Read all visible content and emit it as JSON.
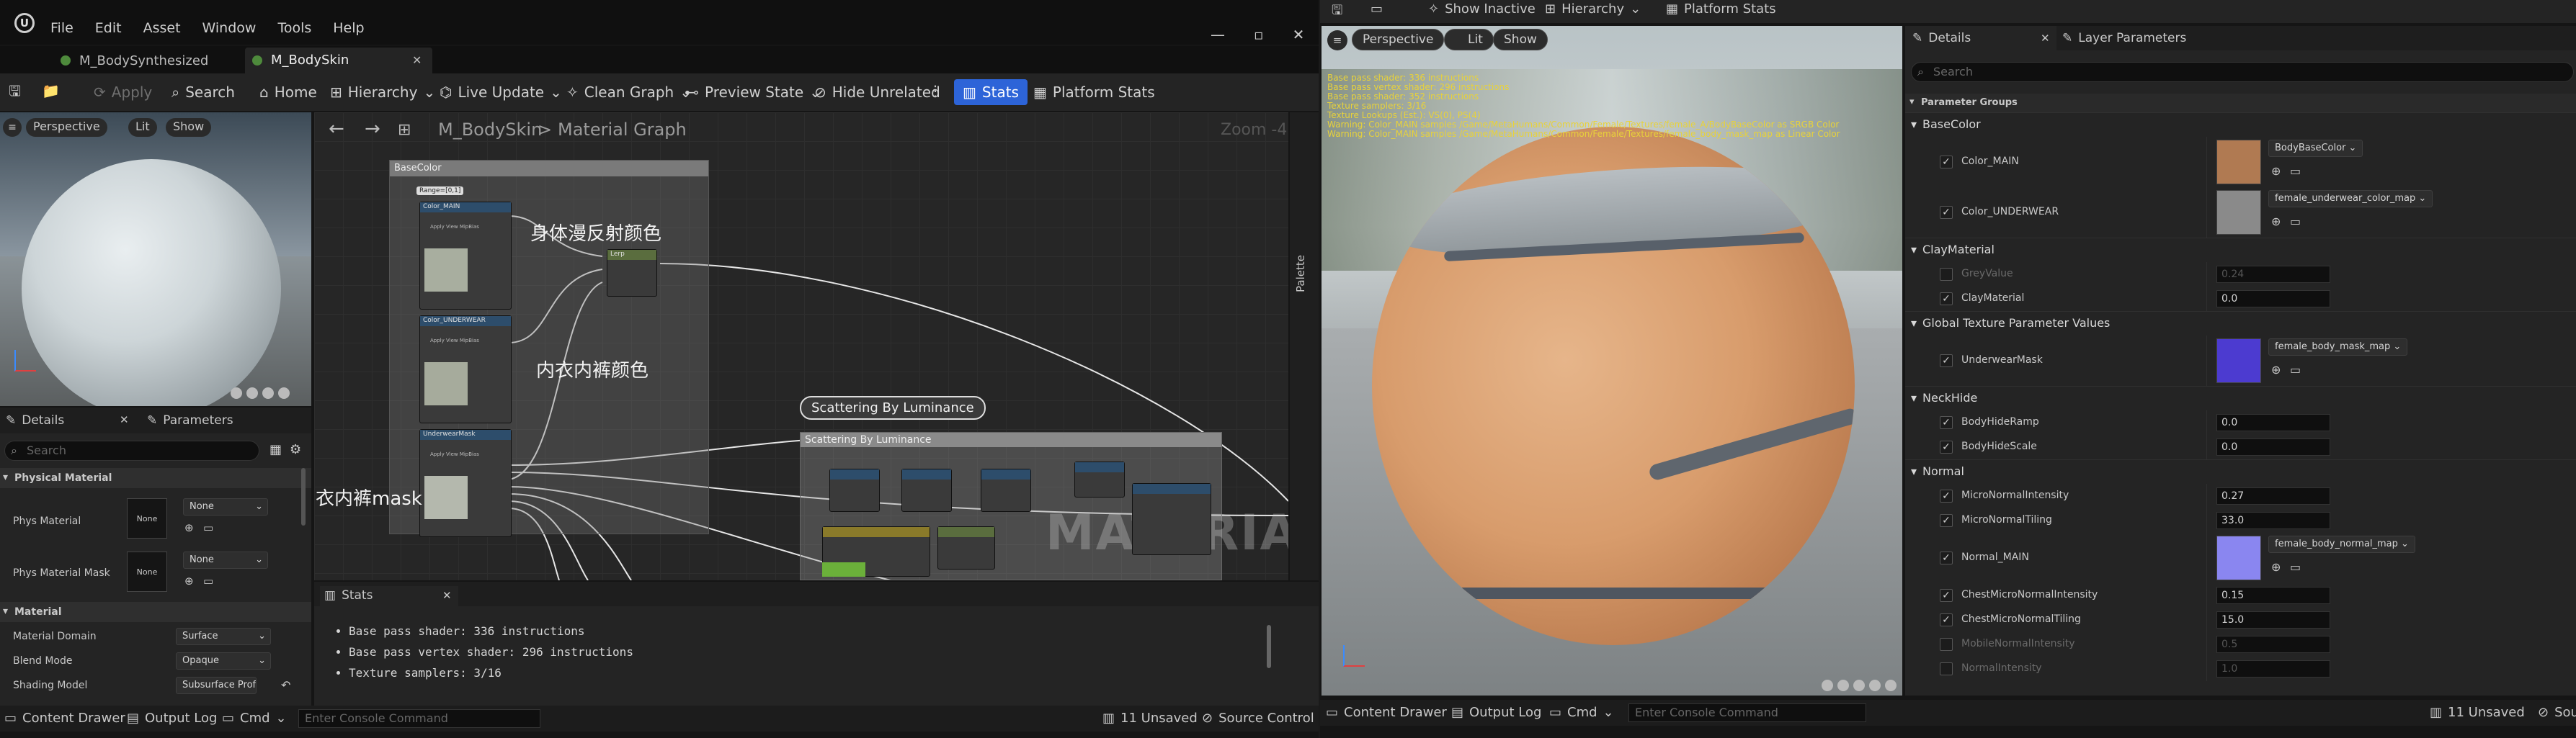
{
  "app": {
    "menu": [
      "File",
      "Edit",
      "Asset",
      "Window",
      "Tools",
      "Help"
    ],
    "tabs": [
      {
        "label": "M_BodySynthesized"
      },
      {
        "label": "M_BodySkin"
      }
    ]
  },
  "toolbar": {
    "apply": "Apply",
    "search": "Search",
    "home": "Home",
    "hierarchy": "Hierarchy",
    "live_update": "Live Update",
    "clean_graph": "Clean Graph",
    "preview_state": "Preview State",
    "hide_unrelated": "Hide Unrelated",
    "stats": "Stats",
    "platform_stats": "Platform Stats"
  },
  "preview": {
    "perspective": "Perspective",
    "lit": "Lit",
    "show": "Show"
  },
  "left_details": {
    "tab_details": "Details",
    "tab_parameters": "Parameters",
    "search_placeholder": "Search",
    "section_physical": "Physical Material",
    "phys_material": "Phys Material",
    "phys_value": "None",
    "phys_thumb": "None",
    "phys_mask": "Phys Material Mask",
    "phys_mask_value": "None",
    "phys_mask_thumb": "None",
    "section_material": "Material",
    "material_domain": "Material Domain",
    "material_domain_value": "Surface",
    "blend_mode": "Blend Mode",
    "blend_mode_value": "Opaque",
    "shading_model": "Shading Model",
    "shading_model_value": "Subsurface Profile"
  },
  "graph": {
    "breadcrumb_root": "M_BodySkin",
    "breadcrumb_sep": ">",
    "breadcrumb_leaf": "Material Graph",
    "zoom": "Zoom -4",
    "palette": "Palette",
    "comment_basecolor": "BaseColor",
    "anno_body_diffuse": "身体漫反射颜色",
    "anno_underwear_color": "内衣内裤颜色",
    "anno_underwear_mask": "内衣内裤mask",
    "scatter_bubble": "Scattering By Luminance",
    "scatter_comment": "Scattering By Luminance",
    "watermark": "MATERIAL",
    "nodes": {
      "range": "Range=[0,1]",
      "color_main": "Color_MAIN",
      "color_underwear": "Color_UNDERWEAR",
      "underwear_mask": "UnderwearMask",
      "lerp": "Lerp",
      "apply_mip": "Apply View MipBias"
    }
  },
  "stats": {
    "title": "Stats",
    "lines": [
      "Base pass shader: 336 instructions",
      "Base pass vertex shader: 296 instructions",
      "Texture samplers: 3/16"
    ]
  },
  "statusbar_left": {
    "content_drawer": "Content Drawer",
    "output_log": "Output Log",
    "cmd": "Cmd",
    "console_placeholder": "Enter Console Command",
    "unsaved": "11 Unsaved",
    "source_control": "Source Control"
  },
  "right_top": {
    "show_inactive": "Show Inactive",
    "hierarchy": "Hierarchy",
    "platform_stats": "Platform Stats"
  },
  "viewport": {
    "perspective": "Perspective",
    "lit": "Lit",
    "show": "Show",
    "overlay_lines": [
      "Base pass shader: 336 instructions",
      "Base pass vertex shader: 296 instructions",
      "Base pass shader: 352 instructions",
      "Texture samplers: 3/16",
      "Texture Lookups (Est.): VS(0), PS(4)",
      "Warning: Color_MAIN samples /Game/MetaHumans/Common/Female/Textures/female_A/BodyBaseColor as SRGB Color",
      "Warning: Color_MAIN samples /Game/MetaHumans/Common/Female/Textures/female_body_mask_map as Linear Color"
    ]
  },
  "right_details": {
    "tab_details": "Details",
    "tab_layer": "Layer Parameters",
    "search_placeholder": "Search",
    "param_groups": "Parameter Groups",
    "groups": [
      {
        "name": "BaseColor",
        "rows": [
          {
            "label": "Color_MAIN",
            "checked": true,
            "type": "texture",
            "value": "BodyBaseColor",
            "swatch": "#b07a52"
          },
          {
            "label": "Color_UNDERWEAR",
            "checked": true,
            "type": "texture",
            "value": "female_underwear_color_map",
            "swatch": "#8a8a8a"
          }
        ]
      },
      {
        "name": "ClayMaterial",
        "rows": [
          {
            "label": "GreyValue",
            "checked": false,
            "type": "value",
            "value": "0.24"
          },
          {
            "label": "ClayMaterial",
            "checked": true,
            "type": "value",
            "value": "0.0"
          }
        ]
      },
      {
        "name": "Global Texture Parameter Values",
        "rows": [
          {
            "label": "UnderwearMask",
            "checked": true,
            "type": "texture",
            "value": "female_body_mask_map",
            "swatch": "#4c3bd0"
          }
        ]
      },
      {
        "name": "NeckHide",
        "rows": [
          {
            "label": "BodyHideRamp",
            "checked": true,
            "type": "value",
            "value": "0.0"
          },
          {
            "label": "BodyHideScale",
            "checked": true,
            "type": "value",
            "value": "0.0"
          }
        ]
      },
      {
        "name": "Normal",
        "rows": [
          {
            "label": "MicroNormalIntensity",
            "checked": true,
            "type": "value",
            "value": "0.27"
          },
          {
            "label": "MicroNormalTiling",
            "checked": true,
            "type": "value",
            "value": "33.0"
          },
          {
            "label": "Normal_MAIN",
            "checked": true,
            "type": "texture",
            "value": "female_body_normal_map",
            "swatch": "#8a86f0"
          },
          {
            "label": "ChestMicroNormalIntensity",
            "checked": true,
            "type": "value",
            "value": "0.15"
          },
          {
            "label": "ChestMicroNormalTiling",
            "checked": true,
            "type": "value",
            "value": "15.0"
          },
          {
            "label": "MobileNormalIntensity",
            "checked": false,
            "type": "value",
            "value": "0.5"
          },
          {
            "label": "NormalIntensity",
            "checked": false,
            "type": "value",
            "value": "1.0"
          }
        ]
      }
    ]
  },
  "statusbar_right": {
    "content_drawer": "Content Drawer",
    "output_log": "Output Log",
    "cmd": "Cmd",
    "console_placeholder": "Enter Console Command",
    "unsaved": "11 Unsaved",
    "source_control": "Sour"
  }
}
